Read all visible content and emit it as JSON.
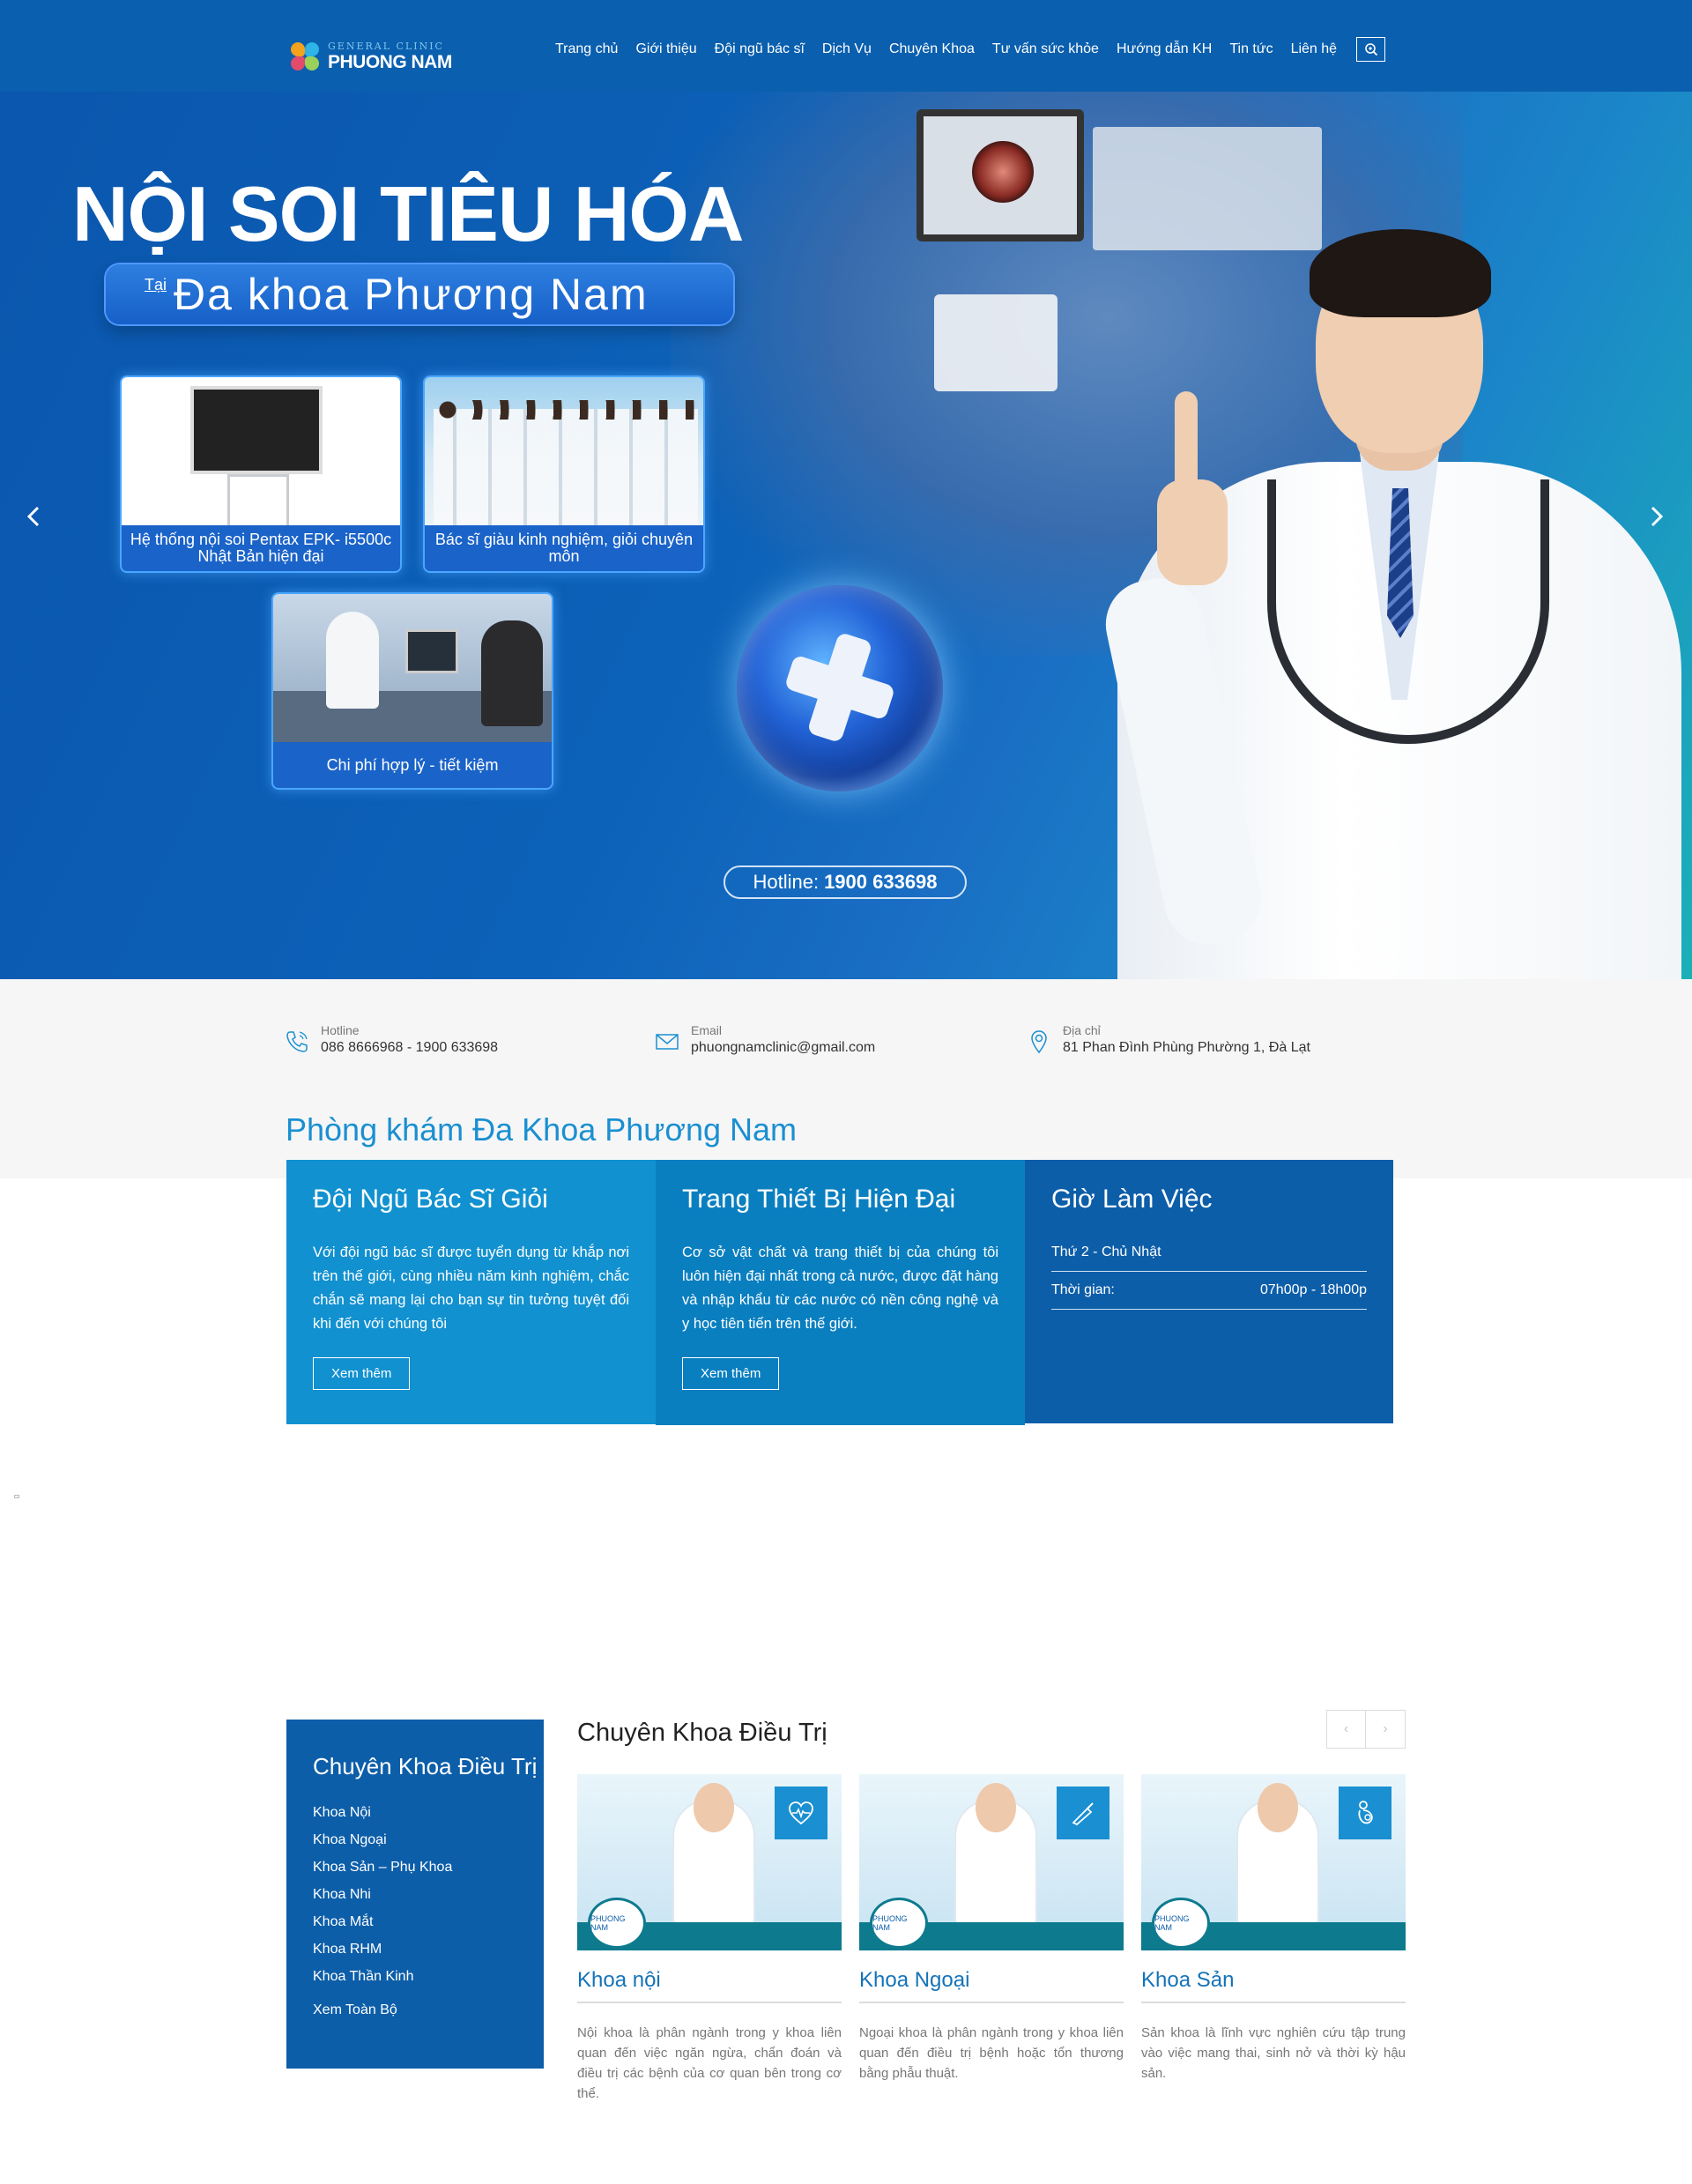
{
  "header": {
    "logo": {
      "sub": "GENERAL CLINIC",
      "name": "PHUONG NAM"
    },
    "nav": [
      "Trang chủ",
      "Giới thiệu",
      "Đội ngũ bác sĩ",
      "Dịch Vụ",
      "Chuyên Khoa",
      "Tư vấn sức khỏe",
      "Hướng dẫn KH",
      "Tin tức",
      "Liên hệ"
    ],
    "search_icon": "search-icon"
  },
  "hero": {
    "title": "NỘI SOI TIÊU HÓA",
    "subtitle_prefix": "Tại",
    "subtitle": "Đa khoa Phương Nam",
    "features": [
      {
        "caption": "Hệ thống nội soi Pentax EPK- i5500c Nhật Bản hiện đại"
      },
      {
        "caption": "Bác sĩ giàu kinh nghiệm, giỏi chuyên môn"
      },
      {
        "caption": "Chi phí hợp lý - tiết kiệm"
      }
    ],
    "hotline_label": "Hotline:",
    "hotline_number": "1900 633698"
  },
  "contact": {
    "hotline": {
      "label": "Hotline",
      "value": "086 8666968 - 1900 633698"
    },
    "email": {
      "label": "Email",
      "value": "phuongnamclinic@gmail.com"
    },
    "address": {
      "label": "Địa chỉ",
      "value": "81 Phan Đình Phùng Phường 1, Đà Lạt"
    }
  },
  "clinic_title": "Phòng khám Đa Khoa Phương Nam",
  "boxes": {
    "doctors": {
      "title": "Đội Ngũ Bác Sĩ Giỏi",
      "text": "Với đội ngũ bác sĩ được tuyển dụng từ khắp nơi trên thế giới, cùng nhiều năm kinh nghiệm, chắc chắn sẽ mang lại cho bạn sự tin tưởng tuyệt đối khi đến với chúng tôi",
      "button": "Xem thêm"
    },
    "equipment": {
      "title": "Trang Thiết Bị Hiện Đại",
      "text": "Cơ sở vật chất và trang thiết bị của chúng tôi luôn hiện đại nhất trong cả nước, được đặt hàng và nhập khẩu từ các nước có nền công nghệ và y học tiên tiến trên thế giới.",
      "button": "Xem thêm"
    },
    "hours": {
      "title": "Giờ Làm Việc",
      "days": "Thứ 2 - Chủ Nhật",
      "time_label": "Thời gian:",
      "time_value": "07h00p - 18h00p"
    }
  },
  "sidebar": {
    "title": "Chuyên Khoa Điều Trị",
    "items": [
      "Khoa Nội",
      "Khoa Ngoại",
      "Khoa Sản – Phụ Khoa",
      "Khoa Nhi",
      "Khoa Mắt",
      "Khoa RHM",
      "Khoa Thần Kinh"
    ],
    "view_all": "Xem Toàn Bộ"
  },
  "specialties": {
    "title": "Chuyên Khoa Điều Trị",
    "pager": {
      "prev": "‹",
      "next": "›"
    },
    "cards": [
      {
        "title": "Khoa nội",
        "icon": "heart-pulse-icon",
        "text": "Nội khoa là phân ngành trong y khoa liên quan đến việc ngăn ngừa, chẩn đoán và điều trị các bệnh của cơ quan bên trong cơ thể."
      },
      {
        "title": "Khoa Ngoại",
        "icon": "scalpel-icon",
        "text": "Ngoại khoa là phân ngành trong y khoa liên quan đến điều trị bệnh hoặc tổn thương bằng phẫu thuật."
      },
      {
        "title": "Khoa Sản",
        "icon": "pregnancy-icon",
        "text": "Sản khoa là lĩnh vực nghiên cứu tập trung vào việc mang thai, sinh nở và thời kỳ hậu sản."
      }
    ],
    "card_badge": "PHUONG NAM"
  },
  "colors": {
    "header_bg": "#0a5fae",
    "accent": "#1a8fd1",
    "box_light": "#1191d0",
    "box_mid": "#0a7fc0",
    "box_dark": "#0d5ea9"
  }
}
